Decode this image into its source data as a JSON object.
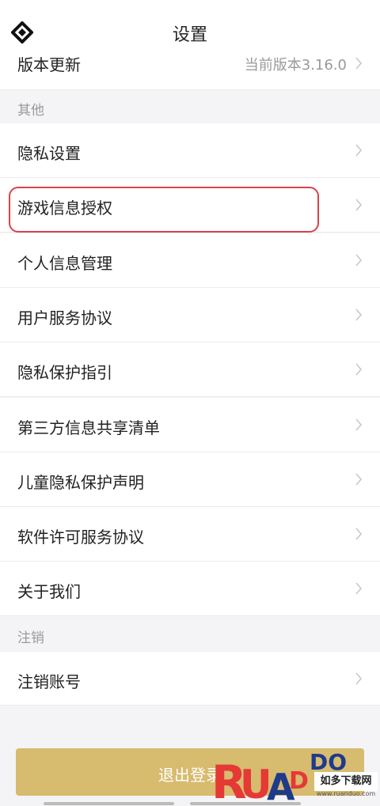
{
  "header": {
    "title": "设置",
    "back_icon": "back-logo-icon"
  },
  "partial_row": {
    "label": "版本更新",
    "value": "当前版本3.16.0"
  },
  "section_other": {
    "label": "其他"
  },
  "items": [
    {
      "label": "隐私设置"
    },
    {
      "label": "游戏信息授权"
    },
    {
      "label": "个人信息管理"
    },
    {
      "label": "用户服务协议"
    },
    {
      "label": "隐私保护指引"
    },
    {
      "label": "第三方信息共享清单"
    },
    {
      "label": "儿童隐私保护声明"
    },
    {
      "label": "软件许可服务协议"
    },
    {
      "label": "关于我们"
    }
  ],
  "section_cancel": {
    "label": "注销"
  },
  "cancel_item": {
    "label": "注销账号"
  },
  "logout": {
    "label": "退出登录"
  },
  "watermark": {
    "brand": "RUANDUO",
    "sub": "如多下载网",
    "url": "www.ruanduo.com"
  },
  "colors": {
    "accent": "#d7bb6f",
    "highlight": "#d9414b"
  }
}
